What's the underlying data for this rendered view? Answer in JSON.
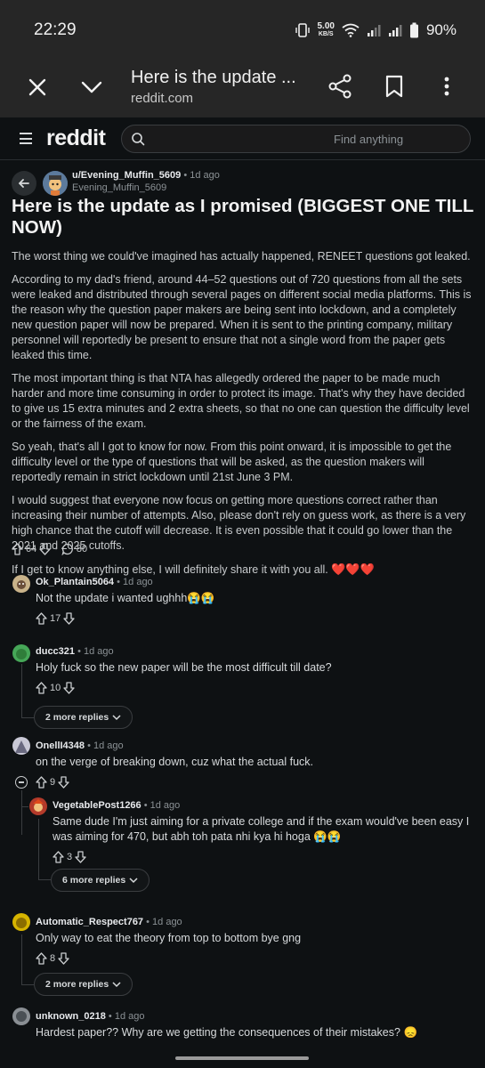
{
  "status_bar": {
    "time": "22:29",
    "speed_value": "5.00",
    "speed_unit": "KB/S",
    "battery": "90%"
  },
  "tab_bar": {
    "title": "Here is the update ...",
    "url": "reddit.com"
  },
  "header": {
    "logo": "reddit",
    "search_placeholder": "Find anything"
  },
  "post": {
    "author": "u/Evening_Muffin_5609",
    "age": "• 1d ago",
    "handle": "Evening_Muffin_5609",
    "title": "Here is the update as I promised (BIGGEST ONE TILL NOW)",
    "body": [
      "The worst thing we could've imagined has actually happened, RENEET questions got leaked.",
      "According to my dad's friend, around 44–52 questions out of 720 questions from all the sets were leaked and distributed through several pages on different social media platforms. This is the reason why the question paper makers are being sent into lockdown, and a completely new question paper will now be prepared. When it is sent to the printing company, military personnel will reportedly be present to ensure that not a single word from the paper gets leaked this time.",
      "The most important thing is that NTA has allegedly ordered the paper to be made much harder and more time consuming in order to protect its image. That's why they have decided to give us 15 extra minutes and 2 extra sheets, so that no one can question the difficulty level or the fairness of the exam.",
      "So yeah, that's all I got to know for now. From this point onward, it is impossible to get the difficulty level or the type of questions that will be asked, as the question makers will reportedly remain in strict lockdown until 21st June 3 PM.",
      "I would suggest that everyone now focus on getting more questions correct rather than increasing their number of attempts. Also, please don't rely on guess work, as there is a very high chance that the cutoff will decrease. It is even possible that it could go lower than the 2021 and 2025 cutoffs.",
      "If I get to know anything else, I will definitely share it with you all."
    ],
    "hearts": "❤️❤️❤️",
    "upvotes": "64",
    "comments": "80"
  },
  "comments": [
    {
      "author": "Ok_Plantain5064",
      "age": "• 1d ago",
      "text": "Not the update i wanted ughhh",
      "emoji": "😭😭",
      "votes": "17"
    },
    {
      "author": "ducc321",
      "age": "• 1d ago",
      "text": "Holy fuck so the new paper will be the most difficult till date?",
      "votes": "10",
      "more": "2 more replies"
    },
    {
      "author": "OnellI4348",
      "age": "• 1d ago",
      "text": "on the verge of breaking down, cuz what the actual fuck.",
      "votes": "9"
    },
    {
      "author": "VegetablePost1266",
      "age": "• 1d ago",
      "text": "Same dude I'm just aiming for a private college and if the exam would've been easy I was aiming for 470, but abh toh pata nhi kya hi hoga",
      "emoji": "😭😭",
      "votes": "3",
      "more": "6 more replies"
    },
    {
      "author": "Automatic_Respect767",
      "age": "• 1d ago",
      "text": "Only way to eat the theory from top to bottom bye gng",
      "votes": "8",
      "more": "2 more replies"
    },
    {
      "author": "unknown_0218",
      "age": "• 1d ago",
      "text": "Hardest paper?? Why are we getting the consequences of their mistakes?",
      "emoji": "😞"
    }
  ],
  "colors": {
    "background": "#0e1113",
    "chrome": "#262626",
    "heart": "#e63946"
  }
}
